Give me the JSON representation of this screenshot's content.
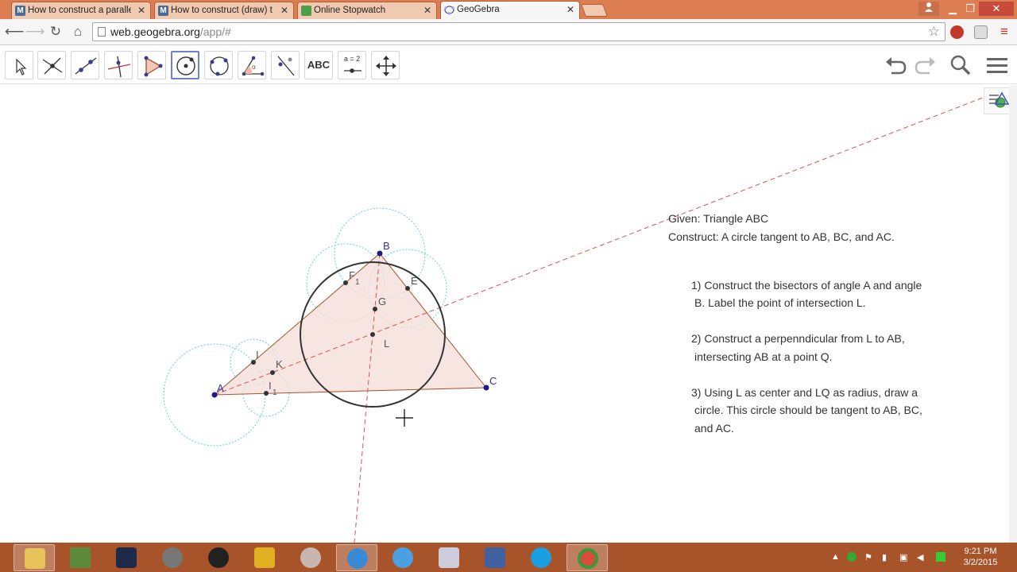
{
  "browser": {
    "tabs": [
      {
        "title": "How to construct a parallel",
        "favicon": "M",
        "favicon_color": "#4a6c9b"
      },
      {
        "title": "How to construct (draw) t",
        "favicon": "M",
        "favicon_color": "#4a6c9b"
      },
      {
        "title": "Online Stopwatch",
        "favicon": "clock-icon",
        "favicon_color": "#4d9e4a"
      },
      {
        "title": "GeoGebra",
        "favicon": "geogebra-icon",
        "favicon_color": "#6d6ca8"
      }
    ],
    "url_host": "web.geogebra.org",
    "url_path": "/app/#"
  },
  "toolbar": {
    "tools": [
      {
        "name": "move-tool",
        "icon": "arrow-cursor-icon"
      },
      {
        "name": "point-tool",
        "icon": "intersect-point-icon"
      },
      {
        "name": "line-tool",
        "icon": "line-through-points-icon"
      },
      {
        "name": "perpendicular-line-tool",
        "icon": "perpendicular-line-icon"
      },
      {
        "name": "polygon-tool",
        "icon": "polygon-icon"
      },
      {
        "name": "circle-center-point-tool",
        "icon": "circle-center-icon"
      },
      {
        "name": "circle-three-points-tool",
        "icon": "circle-three-points-icon"
      },
      {
        "name": "angle-tool",
        "icon": "angle-icon"
      },
      {
        "name": "reflect-tool",
        "icon": "reflect-line-icon"
      },
      {
        "name": "text-tool",
        "icon": "text-icon",
        "label": "ABC"
      },
      {
        "name": "slider-tool",
        "icon": "slider-icon",
        "label": "a = 2"
      },
      {
        "name": "move-graphics-view-tool",
        "icon": "move-view-icon"
      }
    ],
    "selected_tool": "circle-center-point-tool"
  },
  "construction": {
    "points": {
      "A": "A",
      "B": "B",
      "C": "C",
      "E": "E",
      "F1": "F",
      "F1_sub": "1",
      "G": "G",
      "L": "L",
      "I": "I",
      "K": "K",
      "I1": "I",
      "I1_sub": "1"
    },
    "colors": {
      "triangle_fill": "#f5e1da",
      "triangle_edge": "#a0522d",
      "bisector": "#e05050",
      "helper_circle": "#5bd3e6",
      "incircle": "#333333",
      "point": "#1a1a8a"
    }
  },
  "instructions": {
    "given": "Given: Triangle ABC",
    "construct": "Construct: A circle tangent to AB, BC, and AC.",
    "step1_line1": "1) Construct the bisectors of angle A and angle",
    "step1_line2": "B. Label the point of intersection L.",
    "step2_line1": "2) Construct a perpenndicular from L to AB,",
    "step2_line2": "intersecting AB at a point Q.",
    "step3_line1": "3) Using L as center and LQ as radius, draw a",
    "step3_line2": "circle. This circle should be tangent to AB, BC,",
    "step3_line3": "and AC."
  },
  "taskbar": {
    "apps": [
      "file-explorer-icon",
      "minecraft-icon",
      "visual-studio-icon",
      "app-icon",
      "inkscape-icon",
      "media-icon",
      "paint-icon",
      "geogebra-icon",
      "itunes-icon",
      "monitor-icon",
      "network-icon",
      "skype-icon",
      "chrome-icon"
    ],
    "time": "9:21 PM",
    "date": "3/2/2015"
  }
}
